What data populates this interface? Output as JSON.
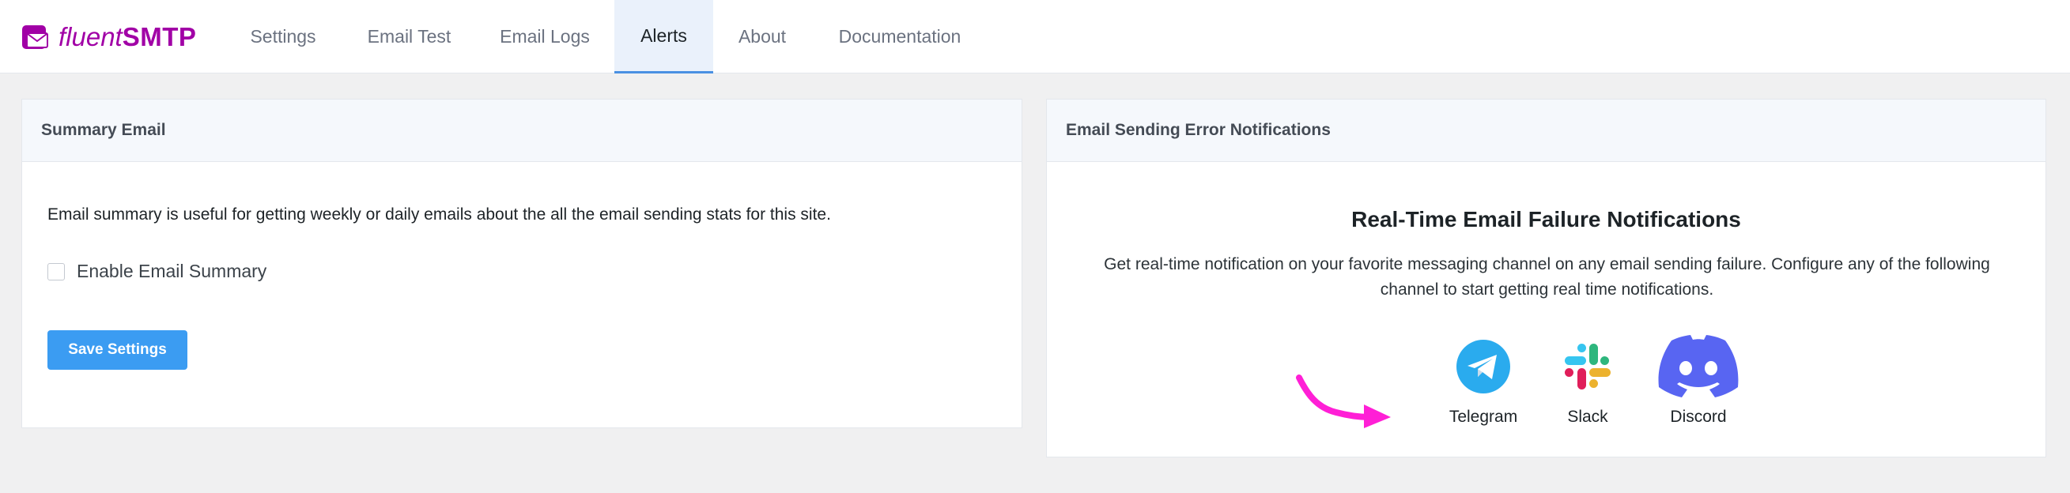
{
  "brand": {
    "name_italic": "fluent",
    "name_bold": "SMTP",
    "color": "#a100a6"
  },
  "nav": {
    "tabs": [
      {
        "label": "Settings"
      },
      {
        "label": "Email Test"
      },
      {
        "label": "Email Logs"
      },
      {
        "label": "Alerts",
        "active": true
      },
      {
        "label": "About"
      },
      {
        "label": "Documentation"
      }
    ]
  },
  "summary_panel": {
    "title": "Summary Email",
    "description": "Email summary is useful for getting weekly or daily emails about the all the email sending stats for this site.",
    "checkbox_label": "Enable Email Summary",
    "checkbox_checked": false,
    "save_label": "Save Settings"
  },
  "error_panel": {
    "title": "Email Sending Error Notifications",
    "heading": "Real-Time Email Failure Notifications",
    "description": "Get real-time notification on your favorite messaging channel on any email sending failure. Configure any of the following channel to start getting real time notifications.",
    "channels": [
      {
        "label": "Telegram",
        "icon": "telegram-icon"
      },
      {
        "label": "Slack",
        "icon": "slack-icon"
      },
      {
        "label": "Discord",
        "icon": "discord-icon"
      }
    ]
  },
  "colors": {
    "accent": "#3b9cf2",
    "active_tab_bg": "#eaf1fb",
    "arrow": "#ff1fd6"
  }
}
